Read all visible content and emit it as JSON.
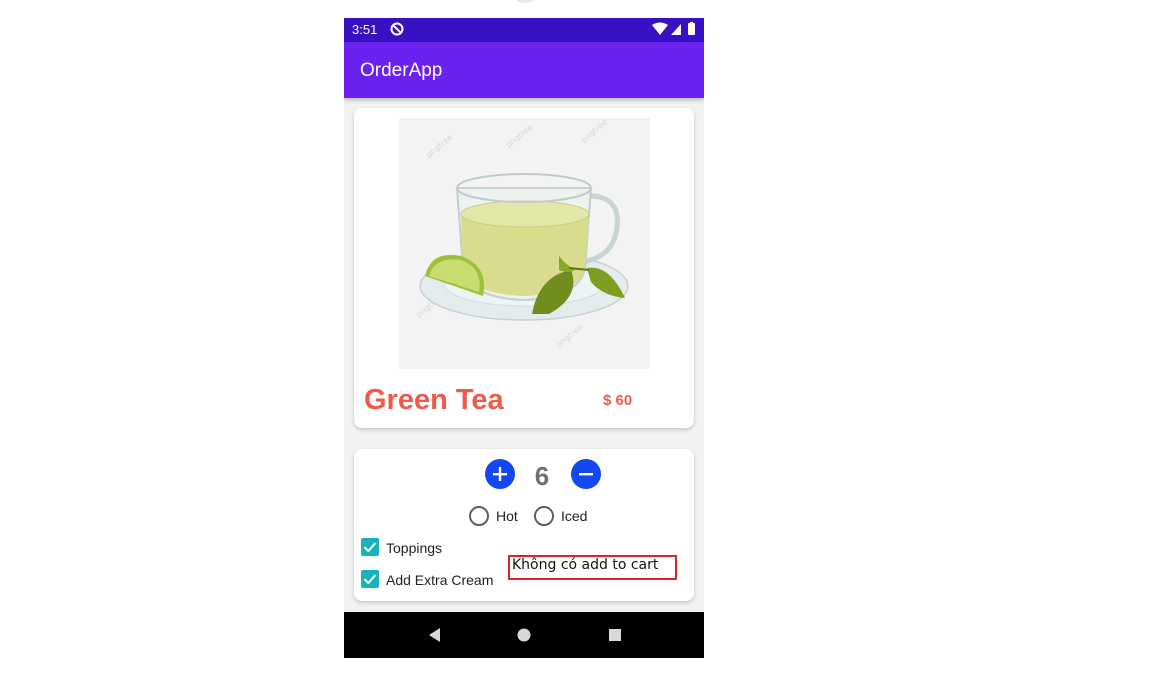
{
  "status_bar": {
    "time": "3:51",
    "icons": [
      "do-not-disturb-icon",
      "wifi-icon",
      "signal-icon",
      "battery-icon"
    ]
  },
  "app_bar": {
    "title": "OrderApp",
    "color": "#6b22f0"
  },
  "product": {
    "name": "Green Tea",
    "price": "$ 60",
    "image": "green-tea-cup-image"
  },
  "quantity": {
    "value": "6",
    "increase_icon": "plus-icon",
    "decrease_icon": "minus-icon"
  },
  "temperature": {
    "options": [
      "Hot",
      "Iced"
    ],
    "selected": null
  },
  "extras": [
    {
      "label": "Toppings",
      "checked": true
    },
    {
      "label": "Add Extra Cream",
      "checked": true
    }
  ],
  "nav_bar": {
    "icons": [
      "back-icon",
      "home-icon",
      "recent-apps-icon"
    ]
  },
  "annotation": {
    "text": "Không có add to cart"
  },
  "colors": {
    "status_bar": "#3a10c4",
    "accent_text": "#f05a4a",
    "button_blue": "#1446f2",
    "checkbox_teal": "#17b3b8",
    "annotation_border": "#e2202a"
  }
}
